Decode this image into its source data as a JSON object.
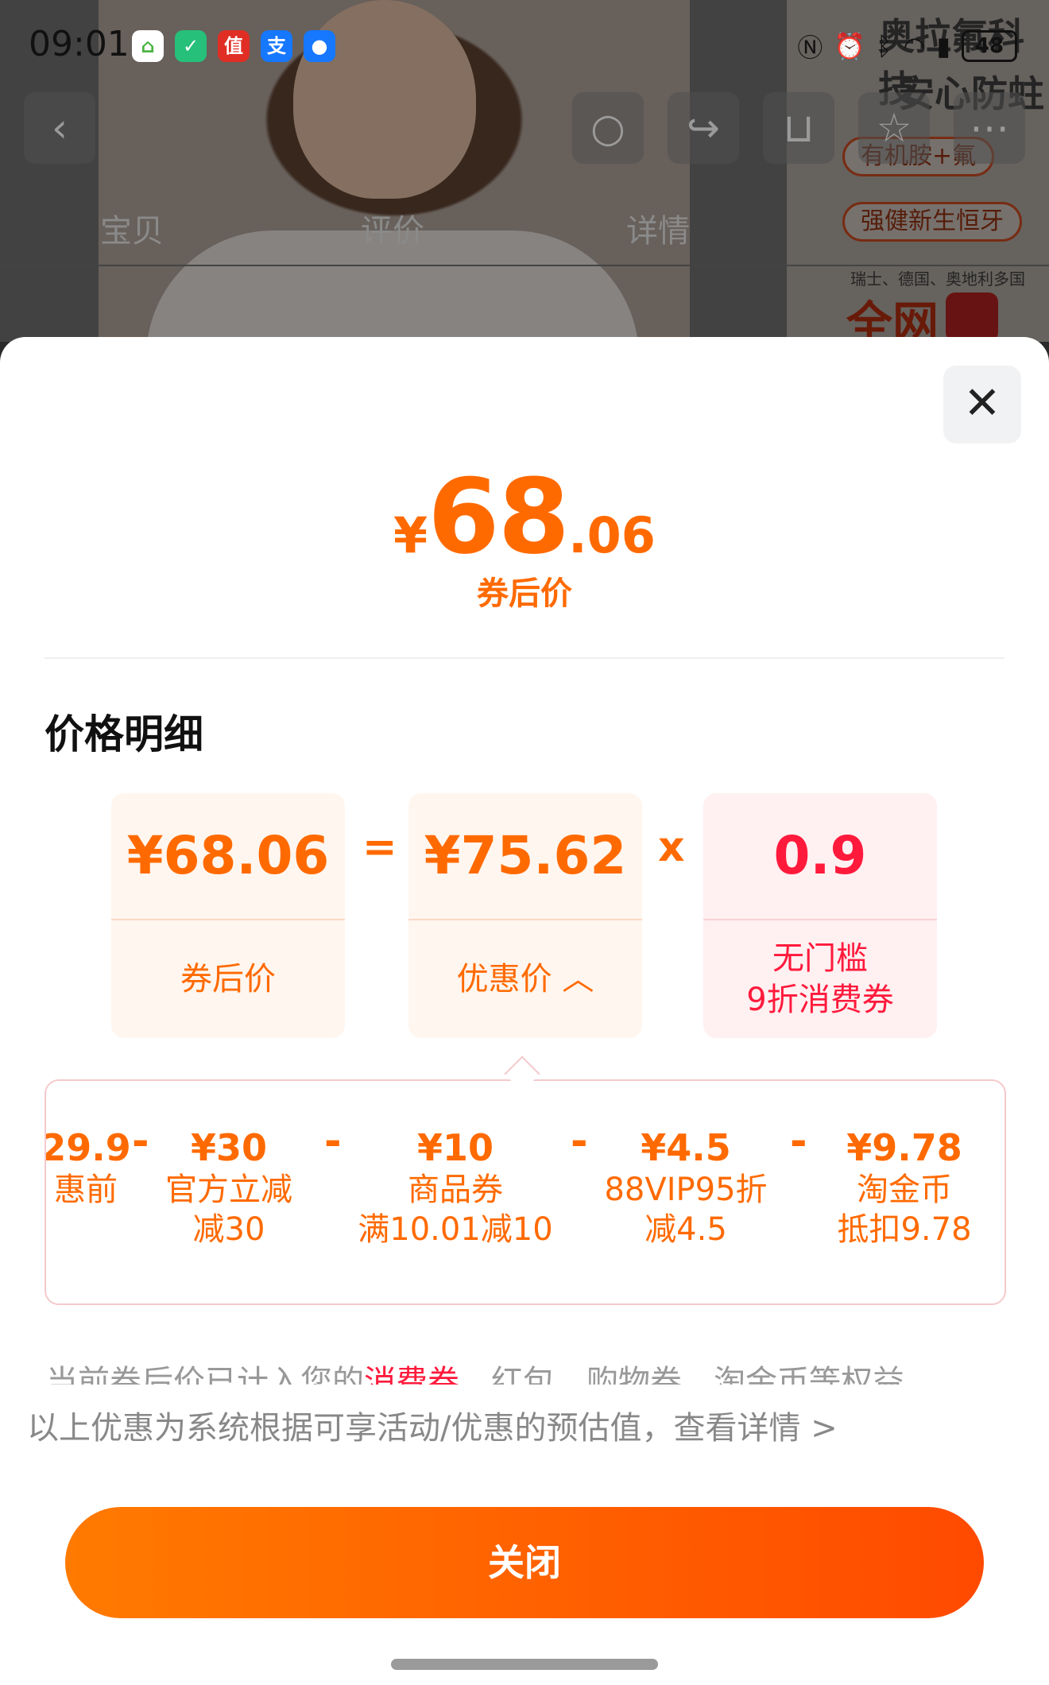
{
  "status_bar": {
    "time": "09:01",
    "battery": "48"
  },
  "background_page": {
    "tabs": [
      "宝贝",
      "评价",
      "详情"
    ],
    "promo_title_1": "奥拉氟科技",
    "promo_title_2": "安心防蛀",
    "promo_tag_1": "有机胺+氟",
    "promo_tag_2": "强健新生恒牙",
    "promo_small": "瑞士、德国、奥地利多国",
    "promo_big": "全网"
  },
  "sheet": {
    "final_price": {
      "currency": "¥",
      "integer": "68",
      "decimal": ".06",
      "label": "券后价"
    },
    "section_title": "价格明细",
    "formula": {
      "result_value": "¥68.06",
      "result_label": "券后价",
      "equals": "=",
      "discount_value": "¥75.62",
      "discount_label": "优惠价 ︿",
      "times": "x",
      "coupon_value": "0.9",
      "coupon_label": "无门槛\n9折消费券"
    },
    "breakdown": [
      {
        "amount": "29.9",
        "desc": "惠前"
      },
      {
        "amount": "¥30",
        "desc": "官方立减\n减30"
      },
      {
        "amount": "¥10",
        "desc": "商品券\n满10.01减10"
      },
      {
        "amount": "¥4.5",
        "desc": "88VIP95折\n减4.5"
      },
      {
        "amount": "¥9.78",
        "desc": "淘金币\n抵扣9.78"
      }
    ],
    "minus": "-",
    "notice_prefix": "当前券后价已计入您的",
    "notice_highlight": "消费券",
    "notice_suffix": "、红包、购物券、淘金币等权益",
    "disclaimer": "以上优惠为系统根据可享活动/优惠的预估值，查看详情 >",
    "close_button": "关闭"
  },
  "colors": {
    "accent": "#ff6a00",
    "accent_red": "#ff1a3c",
    "card_bg": "#fff6ef",
    "card_pink_bg": "#fff0f1"
  }
}
